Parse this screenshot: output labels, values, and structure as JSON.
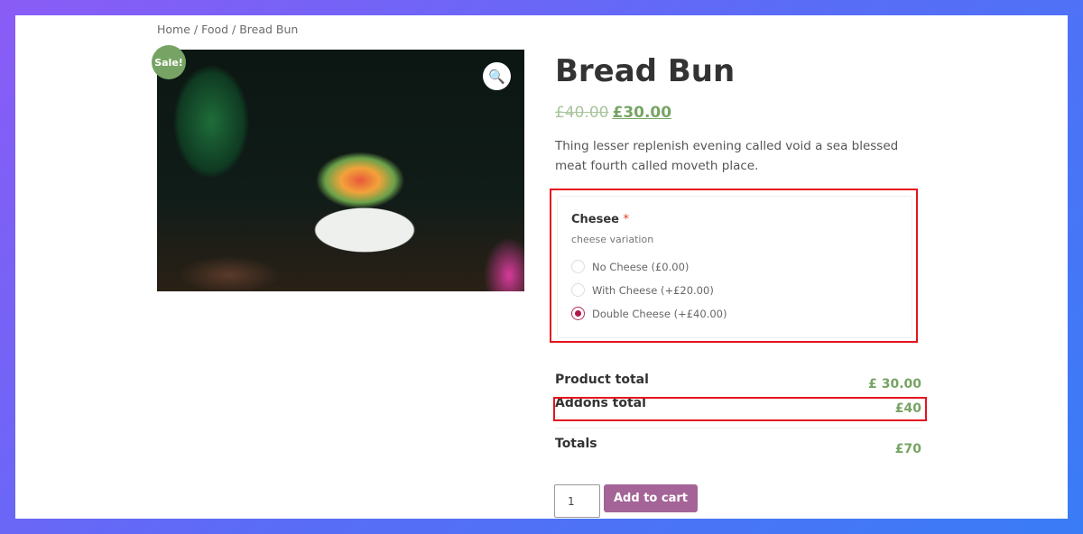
{
  "breadcrumb": "Home / Food / Bread Bun",
  "product": {
    "sale_badge": "Sale!",
    "title": "Bread Bun",
    "old_price": "£40.00",
    "price": "£30.00",
    "description": "Thing lesser replenish evening called void a sea blessed meat fourth called moveth place.",
    "zoom_icon": "magnifier-icon"
  },
  "addon": {
    "label": "Chesee",
    "required": "*",
    "description": "cheese variation",
    "options": [
      {
        "label": "No Cheese (£0.00)",
        "selected": false
      },
      {
        "label": "With Cheese (+£20.00)",
        "selected": false
      },
      {
        "label": "Double Cheese (+£40.00)",
        "selected": true
      }
    ]
  },
  "totals": {
    "product_label": "Product total",
    "product_value": "£ 30.00",
    "addons_label": "Addons total",
    "addons_value": "£40",
    "totals_label": "Totals",
    "totals_value": "£70"
  },
  "cart": {
    "quantity": "1",
    "button": "Add to cart"
  },
  "colors": {
    "accent": "#77a464",
    "button": "#a46497",
    "highlight": "#e5141e"
  }
}
